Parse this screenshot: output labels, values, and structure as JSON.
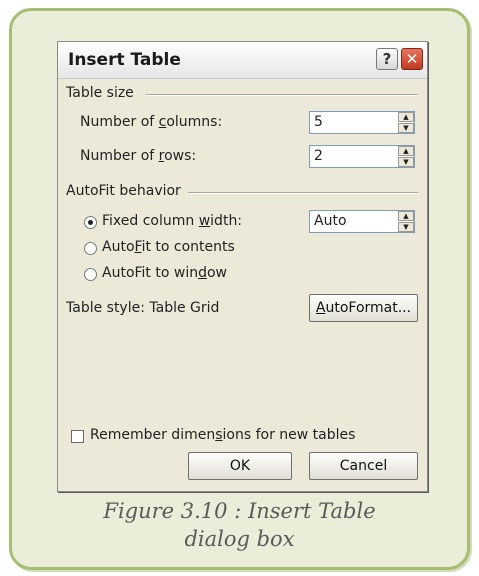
{
  "dialog": {
    "title": "Insert Table",
    "help_glyph": "?",
    "close_glyph": "✕"
  },
  "table_size": {
    "group_label": "Table size",
    "columns_label_pre": "Number of ",
    "columns_label_key": "c",
    "columns_label_post": "olumns:",
    "columns_value": "5",
    "rows_label_pre": "Number of ",
    "rows_label_key": "r",
    "rows_label_post": "ows:",
    "rows_value": "2"
  },
  "autofit": {
    "group_label": "AutoFit behavior",
    "fixed_pre": "Fixed column ",
    "fixed_key": "w",
    "fixed_post": "idth:",
    "fixed_value": "Auto",
    "contents_pre": "Auto",
    "contents_key": "F",
    "contents_post": "it to contents",
    "window_pre": "AutoFit to win",
    "window_key": "d",
    "window_post": "ow",
    "selected": "fixed"
  },
  "table_style": {
    "label": "Table style:  Table Grid",
    "autoformat_key": "A",
    "autoformat_rest": "utoFormat..."
  },
  "remember": {
    "pre": "Remember dimen",
    "key": "s",
    "post": "ions for new tables",
    "checked": false
  },
  "buttons": {
    "ok": "OK",
    "cancel": "Cancel"
  },
  "caption": {
    "line1": "Figure 3.10 : Insert Table",
    "line2": "dialog box"
  },
  "colors": {
    "frame_border": "#a6bd72",
    "frame_fill": "#eaeed8",
    "dialog_face": "#ece9d8",
    "close_button": "#c13a22"
  }
}
